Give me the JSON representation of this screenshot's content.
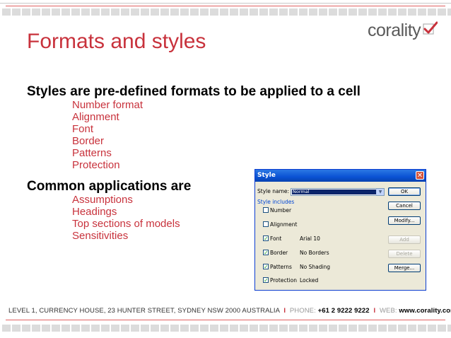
{
  "slide": {
    "title": "Formats and styles",
    "logo_text": "corality",
    "heading1": "Styles are pre-defined formats to be applied to a cell",
    "list1": [
      "Number format",
      "Alignment",
      "Font",
      "Border",
      "Patterns",
      "Protection"
    ],
    "heading2": "Common applications are",
    "list2": [
      "Assumptions",
      "Headings",
      "Top sections of models",
      "Sensitivities"
    ]
  },
  "footer": {
    "address": "LEVEL 1, CURRENCY HOUSE, 23 HUNTER STREET, SYDNEY NSW 2000 AUSTRALIA",
    "phone_label": "PHONE:",
    "phone": "+61 2 9222 9222",
    "web_label": "WEB:",
    "web": "www.corality.com",
    "separator": "I"
  },
  "dialog": {
    "title": "Style",
    "close": "✕",
    "style_name_label": "Style name:",
    "style_name_value": "Normal",
    "style_includes_label": "Style includes",
    "options": [
      {
        "label": "Number",
        "checked": false,
        "value": ""
      },
      {
        "label": "Alignment",
        "checked": false,
        "value": ""
      },
      {
        "label": "Font",
        "checked": true,
        "value": "Arial 10"
      },
      {
        "label": "Border",
        "checked": true,
        "value": "No Borders"
      },
      {
        "label": "Patterns",
        "checked": true,
        "value": "No Shading"
      },
      {
        "label": "Protection",
        "checked": true,
        "value": "Locked"
      }
    ],
    "buttons": {
      "ok": "OK",
      "cancel": "Cancel",
      "modify": "Modify...",
      "add": "Add",
      "delete": "Delete",
      "merge": "Merge..."
    }
  },
  "colors": {
    "accent_red": "#c8323c",
    "xp_blue": "#0a52d4"
  }
}
